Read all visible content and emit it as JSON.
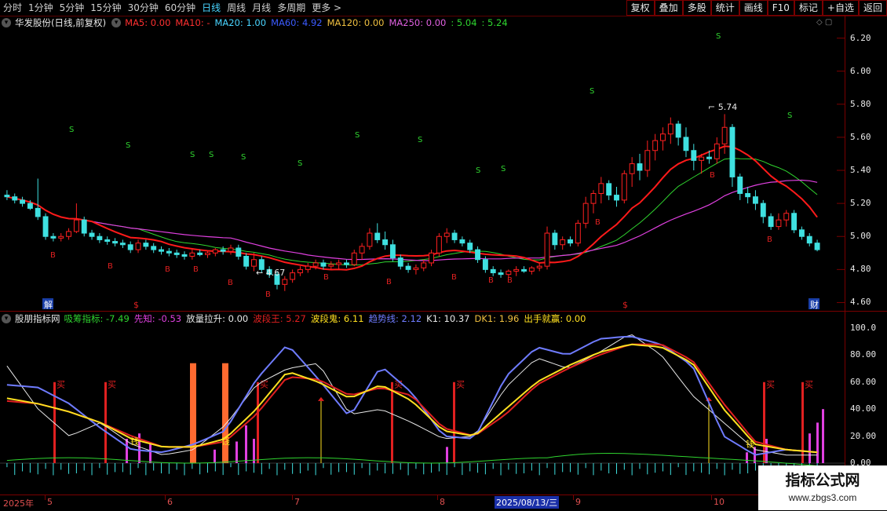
{
  "toolbar": {
    "tabs": [
      "分时",
      "1分钟",
      "5分钟",
      "15分钟",
      "30分钟",
      "60分钟",
      "日线",
      "周线",
      "月线",
      "多周期",
      "更多 >"
    ],
    "active_tab": "日线",
    "buttons": [
      "复权",
      "叠加",
      "多股",
      "统计",
      "画线",
      "F10",
      "标记",
      "+自选",
      "返回"
    ]
  },
  "price_panel": {
    "title": "华发股份(日线,前复权)",
    "ma": [
      {
        "label": "MA5: 0.00",
        "color": "#ff3030"
      },
      {
        "label": "MA10: -",
        "color": "#ff3030"
      },
      {
        "label": "MA20: 1.00",
        "color": "#49d4ff"
      },
      {
        "label": "MA60: 4.92",
        "color": "#3b5bff"
      },
      {
        "label": "MA120: 0.00",
        "color": "#f0c040"
      },
      {
        "label": "MA250: 0.00",
        "color": "#e060e0"
      },
      {
        "label": ": 5.04",
        "color": "#2fd42f"
      },
      {
        "label": ": 5.24",
        "color": "#2fd42f"
      }
    ],
    "axis_ticks": [
      "6.20",
      "6.00",
      "5.80",
      "5.60",
      "5.40",
      "5.20",
      "5.00",
      "4.80",
      "4.60"
    ],
    "high_label": "5.74",
    "low_label": "4.67",
    "bottom_tags": [
      "解",
      "$",
      "$",
      "财"
    ]
  },
  "indicator_panel": {
    "title": "股朋指标网",
    "items": [
      {
        "label": "吸筹指标: -7.49",
        "color": "#2fd42f"
      },
      {
        "label": "先知: -0.53",
        "color": "#e040e0"
      },
      {
        "label": "放量拉升: 0.00",
        "color": "#e8e8e8"
      },
      {
        "label": "波段王: 5.27",
        "color": "#e02020"
      },
      {
        "label": "波段鬼: 6.11",
        "color": "#ffe020"
      },
      {
        "label": "趋势线: 2.12",
        "color": "#6f7cff"
      },
      {
        "label": "K1: 10.37",
        "color": "#e8e8e8"
      },
      {
        "label": "DK1: 1.96",
        "color": "#f0c040"
      },
      {
        "label": "出手就赢: 0.00",
        "color": "#ffe020"
      }
    ],
    "axis_ticks": [
      "100.0",
      "80.00",
      "60.00",
      "40.00",
      "20.00",
      "0.00"
    ],
    "buy_label": "买",
    "money_label": "钱"
  },
  "date_axis": {
    "labels": [
      "2025年",
      "5",
      "6",
      "7",
      "8",
      "2025/08/13/三",
      "9",
      "10"
    ]
  },
  "watermark": {
    "title": "指标公式网",
    "url": "www.zbgs3.com"
  },
  "colors": {
    "up": "#ff2020",
    "down": "#3fe0e0",
    "ma_fast": "#ff1a1a",
    "ma_slow": "#e040e0",
    "ma_green": "#2fd42f"
  },
  "chart_data": {
    "type": "candlestick",
    "ylim": [
      4.55,
      6.25
    ],
    "candles": [
      [
        5.25,
        5.28,
        5.22,
        5.24
      ],
      [
        5.24,
        5.26,
        5.2,
        5.22
      ],
      [
        5.22,
        5.24,
        5.18,
        5.2
      ],
      [
        5.2,
        5.22,
        5.16,
        5.17
      ],
      [
        5.17,
        5.35,
        5.1,
        5.12
      ],
      [
        5.12,
        5.14,
        4.98,
        5.0
      ],
      [
        5.0,
        5.02,
        4.97,
        4.99
      ],
      [
        4.99,
        5.02,
        4.97,
        5.0
      ],
      [
        5.0,
        5.05,
        4.98,
        5.03
      ],
      [
        5.03,
        5.2,
        5.02,
        5.1
      ],
      [
        5.1,
        5.12,
        5.0,
        5.02
      ],
      [
        5.02,
        5.04,
        4.98,
        5.0
      ],
      [
        5.0,
        5.02,
        4.96,
        4.98
      ],
      [
        4.98,
        5.0,
        4.95,
        4.97
      ],
      [
        4.97,
        4.99,
        4.94,
        4.96
      ],
      [
        4.96,
        4.98,
        4.93,
        4.95
      ],
      [
        4.95,
        4.97,
        4.9,
        4.92
      ],
      [
        4.92,
        4.98,
        4.9,
        4.96
      ],
      [
        4.96,
        4.98,
        4.92,
        4.94
      ],
      [
        4.94,
        4.96,
        4.9,
        4.92
      ],
      [
        4.92,
        4.94,
        4.89,
        4.91
      ],
      [
        4.91,
        4.93,
        4.88,
        4.9
      ],
      [
        4.9,
        4.92,
        4.87,
        4.89
      ],
      [
        4.89,
        4.91,
        4.86,
        4.88
      ],
      [
        4.88,
        4.92,
        4.86,
        4.9
      ],
      [
        4.9,
        4.92,
        4.88,
        4.89
      ],
      [
        4.89,
        4.91,
        4.87,
        4.9
      ],
      [
        4.9,
        4.93,
        4.88,
        4.92
      ],
      [
        4.92,
        4.94,
        4.89,
        4.91
      ],
      [
        4.91,
        4.95,
        4.89,
        4.93
      ],
      [
        4.93,
        4.95,
        4.86,
        4.88
      ],
      [
        4.88,
        4.9,
        4.8,
        4.82
      ],
      [
        4.82,
        4.9,
        4.79,
        4.86
      ],
      [
        4.86,
        4.88,
        4.78,
        4.8
      ],
      [
        4.8,
        4.82,
        4.75,
        4.77
      ],
      [
        4.77,
        4.79,
        4.68,
        4.71
      ],
      [
        4.71,
        4.76,
        4.67,
        4.74
      ],
      [
        4.74,
        4.8,
        4.72,
        4.78
      ],
      [
        4.78,
        4.82,
        4.76,
        4.8
      ],
      [
        4.8,
        4.84,
        4.78,
        4.82
      ],
      [
        4.82,
        4.86,
        4.8,
        4.84
      ],
      [
        4.84,
        4.86,
        4.8,
        4.82
      ],
      [
        4.82,
        4.85,
        4.8,
        4.83
      ],
      [
        4.83,
        4.86,
        4.8,
        4.84
      ],
      [
        4.84,
        4.86,
        4.81,
        4.83
      ],
      [
        4.83,
        4.92,
        4.82,
        4.9
      ],
      [
        4.9,
        4.96,
        4.86,
        4.94
      ],
      [
        4.94,
        5.05,
        4.92,
        5.02
      ],
      [
        5.02,
        5.08,
        4.96,
        4.98
      ],
      [
        4.98,
        5.03,
        4.92,
        4.95
      ],
      [
        4.95,
        4.98,
        4.85,
        4.87
      ],
      [
        4.87,
        4.89,
        4.8,
        4.82
      ],
      [
        4.82,
        4.84,
        4.78,
        4.8
      ],
      [
        4.8,
        4.83,
        4.77,
        4.81
      ],
      [
        4.81,
        4.86,
        4.79,
        4.84
      ],
      [
        4.84,
        4.92,
        4.82,
        4.9
      ],
      [
        4.9,
        5.02,
        4.88,
        5.0
      ],
      [
        5.0,
        5.05,
        4.96,
        5.02
      ],
      [
        5.02,
        5.04,
        4.96,
        4.98
      ],
      [
        4.98,
        5.0,
        4.94,
        4.96
      ],
      [
        4.96,
        4.98,
        4.9,
        4.92
      ],
      [
        4.92,
        4.94,
        4.84,
        4.86
      ],
      [
        4.86,
        4.88,
        4.78,
        4.8
      ],
      [
        4.8,
        4.82,
        4.76,
        4.78
      ],
      [
        4.78,
        4.8,
        4.75,
        4.77
      ],
      [
        4.77,
        4.8,
        4.75,
        4.79
      ],
      [
        4.79,
        4.82,
        4.76,
        4.8
      ],
      [
        4.8,
        4.82,
        4.78,
        4.79
      ],
      [
        4.79,
        4.82,
        4.77,
        4.81
      ],
      [
        4.81,
        4.84,
        4.79,
        4.82
      ],
      [
        4.82,
        5.06,
        4.8,
        5.02
      ],
      [
        5.02,
        5.04,
        4.92,
        4.95
      ],
      [
        4.95,
        5.0,
        4.92,
        4.98
      ],
      [
        4.98,
        5.0,
        4.94,
        4.96
      ],
      [
        4.96,
        5.1,
        4.94,
        5.08
      ],
      [
        5.08,
        5.24,
        5.05,
        5.2
      ],
      [
        5.2,
        5.28,
        5.14,
        5.26
      ],
      [
        5.26,
        5.36,
        5.2,
        5.32
      ],
      [
        5.32,
        5.34,
        5.22,
        5.25
      ],
      [
        5.25,
        5.3,
        5.18,
        5.22
      ],
      [
        5.22,
        5.4,
        5.2,
        5.38
      ],
      [
        5.38,
        5.48,
        5.3,
        5.44
      ],
      [
        5.44,
        5.5,
        5.34,
        5.4
      ],
      [
        5.4,
        5.58,
        5.36,
        5.52
      ],
      [
        5.52,
        5.62,
        5.46,
        5.58
      ],
      [
        5.58,
        5.66,
        5.52,
        5.62
      ],
      [
        5.62,
        5.72,
        5.56,
        5.68
      ],
      [
        5.68,
        5.7,
        5.55,
        5.6
      ],
      [
        5.6,
        5.66,
        5.48,
        5.52
      ],
      [
        5.52,
        5.56,
        5.4,
        5.46
      ],
      [
        5.46,
        5.5,
        5.38,
        5.48
      ],
      [
        5.48,
        5.52,
        5.44,
        5.47
      ],
      [
        5.47,
        5.6,
        5.44,
        5.56
      ],
      [
        5.56,
        5.74,
        5.5,
        5.66
      ],
      [
        5.66,
        5.68,
        5.3,
        5.36
      ],
      [
        5.36,
        5.38,
        5.22,
        5.26
      ],
      [
        5.26,
        5.3,
        5.2,
        5.24
      ],
      [
        5.24,
        5.28,
        5.16,
        5.2
      ],
      [
        5.2,
        5.22,
        5.08,
        5.12
      ],
      [
        5.12,
        5.14,
        5.04,
        5.06
      ],
      [
        5.06,
        5.14,
        5.04,
        5.1
      ],
      [
        5.1,
        5.16,
        5.06,
        5.14
      ],
      [
        5.14,
        5.16,
        5.02,
        5.04
      ],
      [
        5.04,
        5.06,
        4.98,
        5.0
      ],
      [
        5.0,
        5.02,
        4.94,
        4.96
      ],
      [
        4.96,
        4.98,
        4.91,
        4.92
      ]
    ],
    "s_markers": 13,
    "b_markers": 12
  }
}
